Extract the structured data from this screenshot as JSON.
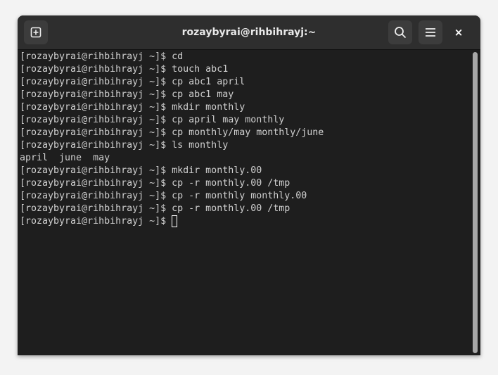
{
  "window": {
    "title": "rozaybyrai@rihbihrayj:~"
  },
  "header": {
    "new_tab_icon": "plus-square-icon",
    "search_icon": "search-icon",
    "menu_icon": "hamburger-menu-icon",
    "close_label": "×"
  },
  "terminal": {
    "lines": [
      "[rozaybyrai@rihbihrayj ~]$ cd",
      "[rozaybyrai@rihbihrayj ~]$ touch abc1",
      "[rozaybyrai@rihbihrayj ~]$ cp abc1 april",
      "[rozaybyrai@rihbihrayj ~]$ cp abc1 may",
      "[rozaybyrai@rihbihrayj ~]$ mkdir monthly",
      "[rozaybyrai@rihbihrayj ~]$ cp april may monthly",
      "[rozaybyrai@rihbihrayj ~]$ cp monthly/may monthly/june",
      "[rozaybyrai@rihbihrayj ~]$ ls monthly",
      "april  june  may",
      "[rozaybyrai@rihbihrayj ~]$ mkdir monthly.00",
      "[rozaybyrai@rihbihrayj ~]$ cp -r monthly.00 /tmp",
      "[rozaybyrai@rihbihrayj ~]$ cp -r monthly monthly.00",
      "[rozaybyrai@rihbihrayj ~]$ cp -r monthly.00 /tmp"
    ],
    "prompt": "[rozaybyrai@rihbihrayj ~]$ "
  }
}
